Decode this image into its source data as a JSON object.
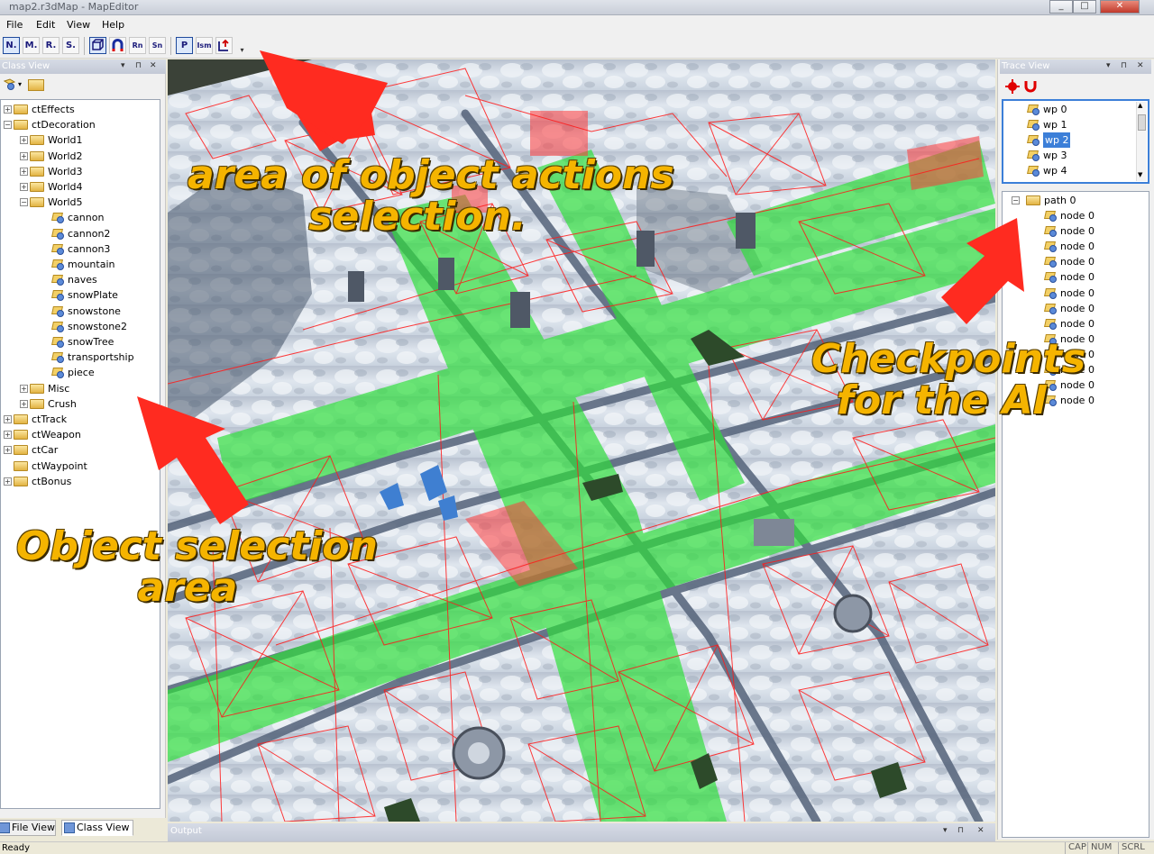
{
  "window": {
    "title": "map2.r3dMap - MapEditor",
    "controls": [
      "_",
      "□",
      "✕"
    ]
  },
  "menu": [
    "File",
    "Edit",
    "View",
    "Help"
  ],
  "toolbar": {
    "buttons": [
      "N.",
      "M.",
      "R.",
      "S.",
      "",
      "",
      "Rn",
      "Sn",
      "P",
      "Ism",
      ""
    ]
  },
  "class_view": {
    "title": "Class View",
    "tree": [
      {
        "text": "ctEffects",
        "level": 0,
        "exp": "+"
      },
      {
        "text": "ctDecoration",
        "level": 0,
        "exp": "-"
      },
      {
        "text": "World1",
        "level": 1,
        "exp": "+"
      },
      {
        "text": "World2",
        "level": 1,
        "exp": "+"
      },
      {
        "text": "World3",
        "level": 1,
        "exp": "+"
      },
      {
        "text": "World4",
        "level": 1,
        "exp": "+"
      },
      {
        "text": "World5",
        "level": 1,
        "exp": "-"
      },
      {
        "text": "cannon",
        "level": 2,
        "leaf": true
      },
      {
        "text": "cannon2",
        "level": 2,
        "leaf": true
      },
      {
        "text": "cannon3",
        "level": 2,
        "leaf": true
      },
      {
        "text": "mountain",
        "level": 2,
        "leaf": true
      },
      {
        "text": "naves",
        "level": 2,
        "leaf": true
      },
      {
        "text": "snowPlate",
        "level": 2,
        "leaf": true
      },
      {
        "text": "snowstone",
        "level": 2,
        "leaf": true
      },
      {
        "text": "snowstone2",
        "level": 2,
        "leaf": true
      },
      {
        "text": "snowTree",
        "level": 2,
        "leaf": true
      },
      {
        "text": "transportship",
        "level": 2,
        "leaf": true
      },
      {
        "text": "piece",
        "level": 2,
        "leaf": true
      },
      {
        "text": "Misc",
        "level": 1,
        "exp": "+"
      },
      {
        "text": "Crush",
        "level": 1,
        "exp": "+"
      },
      {
        "text": "ctTrack",
        "level": 0,
        "exp": "+"
      },
      {
        "text": "ctWeapon",
        "level": 0,
        "exp": "+"
      },
      {
        "text": "ctCar",
        "level": 0,
        "exp": "+"
      },
      {
        "text": "ctWaypoint",
        "level": 0,
        "exp": ""
      },
      {
        "text": "ctBonus",
        "level": 0,
        "exp": "+"
      }
    ],
    "tabs": [
      {
        "label": "File View",
        "active": false
      },
      {
        "label": "Class View",
        "active": true
      }
    ]
  },
  "trace_view": {
    "title": "Trace View",
    "waypoints": [
      "wp 0",
      "wp 1",
      "wp 2",
      "wp 3",
      "wp 4"
    ],
    "selected_waypoint": "wp 2",
    "path": "path 0",
    "nodes": [
      "node 0",
      "node 0",
      "node 0",
      "node 0",
      "node 0",
      "node 0",
      "node 0",
      "node 0",
      "node 0",
      "node 0",
      "node 0",
      "node 0",
      "node 0"
    ]
  },
  "output": {
    "title": "Output"
  },
  "status": {
    "text": "Ready",
    "indicators": [
      "CAP",
      "NUM",
      "SCRL"
    ]
  },
  "annotations": {
    "actions": [
      "area of object actions",
      "selection."
    ],
    "checkpoints": [
      "Checkpoints",
      "for the AI"
    ],
    "selection": [
      "Object selection",
      "area"
    ]
  },
  "colors": {
    "accent": "#3c7fd8",
    "path_green": "#2ee03a",
    "wire_red": "#ff1a1a",
    "annotation": "#f5b400"
  }
}
